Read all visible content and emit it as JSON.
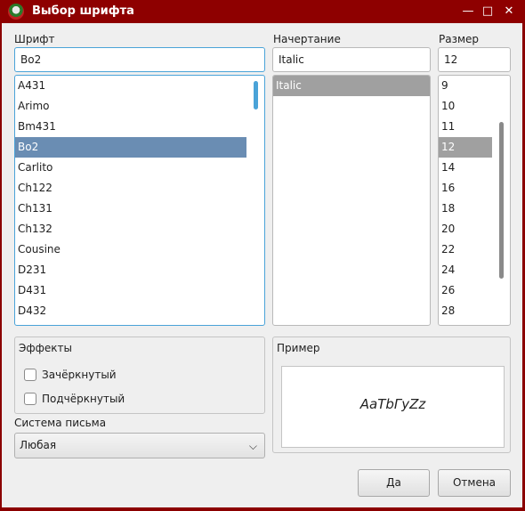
{
  "window": {
    "title": "Выбор шрифта",
    "minimize": "—",
    "maximize": "□",
    "close": "✕"
  },
  "font": {
    "label": "Шрифт",
    "value": "Bo2",
    "items": [
      "A431",
      "Arimo",
      "Bm431",
      "Bo2",
      "Carlito",
      "Ch122",
      "Ch131",
      "Ch132",
      "Cousine",
      "D231",
      "D431",
      "D432"
    ],
    "selected": "Bo2"
  },
  "style": {
    "label": "Начертание",
    "value": "Italic",
    "items": [
      "Italic"
    ],
    "selected": "Italic"
  },
  "size": {
    "label": "Размер",
    "value": "12",
    "items": [
      "9",
      "10",
      "11",
      "12",
      "14",
      "16",
      "18",
      "20",
      "22",
      "24",
      "26",
      "28"
    ],
    "selected": "12"
  },
  "effects": {
    "label": "Эффекты",
    "strikeout": "Зачёркнутый",
    "underline": "Подчёркнутый",
    "strikeout_checked": false,
    "underline_checked": false
  },
  "writing_system": {
    "label": "Система письма",
    "value": "Любая"
  },
  "sample": {
    "label": "Пример",
    "text": "AaTbГyZz"
  },
  "buttons": {
    "ok": "Да",
    "cancel": "Отмена"
  },
  "colors": {
    "titlebar": "#8e0000",
    "selection": "#6a8db3",
    "focus": "#4aa3d8",
    "scroll_thumb": "#4aa3d8"
  }
}
